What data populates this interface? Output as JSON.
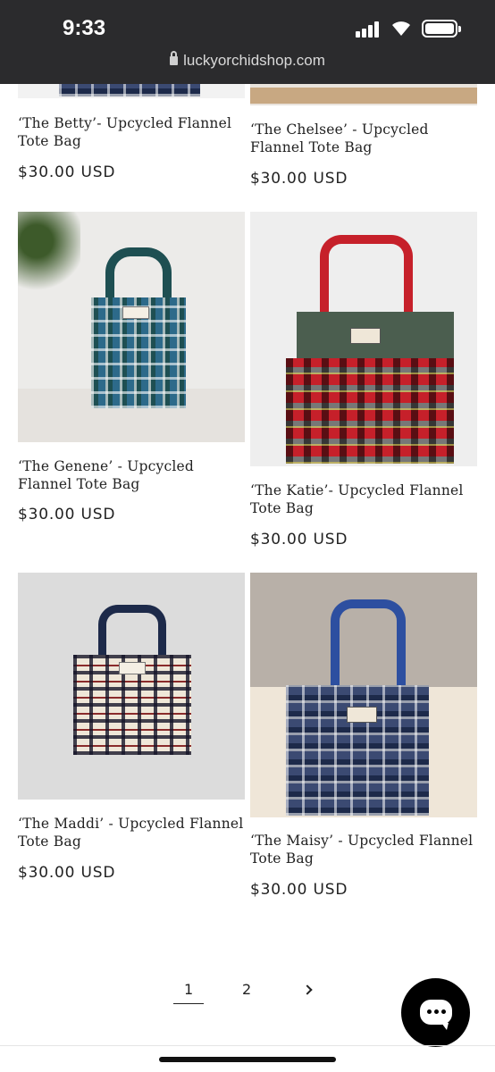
{
  "status_bar": {
    "time": "9:33",
    "signal_icon": "signal-bars-icon",
    "wifi_icon": "wifi-icon",
    "battery_icon": "battery-icon"
  },
  "browser": {
    "url": "luckyorchidshop.com",
    "lock_icon": "lock-icon"
  },
  "products": [
    {
      "title": "‘The Betty’- Upcycled Flannel Tote Bag",
      "price": "$30.00 USD"
    },
    {
      "title": "‘The Chelsee’ - Upcycled Flannel Tote Bag",
      "price": "$30.00 USD"
    },
    {
      "title": "‘The Genene’ - Upcycled Flannel Tote Bag",
      "price": "$30.00 USD"
    },
    {
      "title": "‘The Katie’- Upcycled Flannel Tote Bag",
      "price": "$30.00 USD"
    },
    {
      "title": "‘The Maddi’ - Upcycled Flannel Tote Bag",
      "price": "$30.00 USD"
    },
    {
      "title": "‘The Maisy’ - Upcycled Flannel Tote Bag",
      "price": "$30.00 USD"
    }
  ],
  "pagination": {
    "pages": [
      "1",
      "2"
    ],
    "current": "1",
    "next_icon": "chevron-right-icon"
  },
  "chat": {
    "icon": "chat-bubble-icon"
  }
}
